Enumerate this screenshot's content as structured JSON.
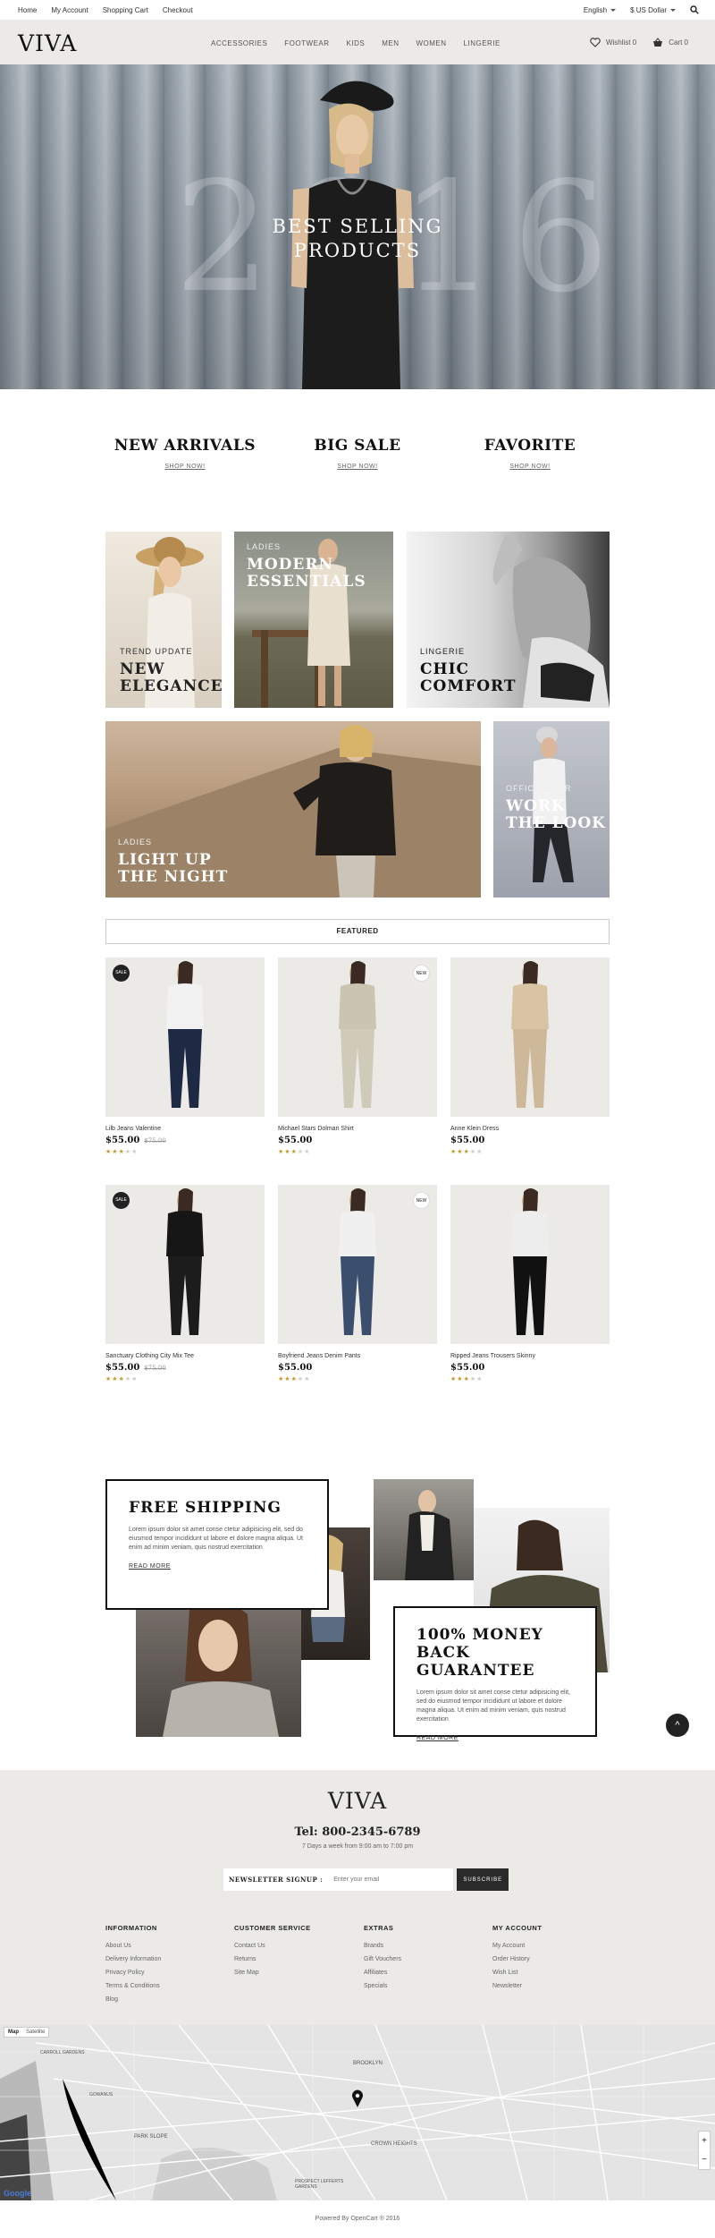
{
  "topbar": {
    "links": [
      "Home",
      "My Account",
      "Shopping Cart",
      "Checkout"
    ],
    "language": "English",
    "currency": "$ US Dollar"
  },
  "header": {
    "logo": "VIVA",
    "nav": [
      "ACCESSORIES",
      "FOOTWEAR",
      "KIDS",
      "MEN",
      "WOMEN",
      "LINGERIE"
    ],
    "wishlist": "Wishlist 0",
    "cart": "Cart 0"
  },
  "hero": {
    "year": "2016",
    "title_line1": "BEST SELLING",
    "title_line2": "PRODUCTS"
  },
  "categories": [
    {
      "title": "NEW ARRIVALS",
      "link": "SHOP NOW!"
    },
    {
      "title": "BIG SALE",
      "link": "SHOP NOW!"
    },
    {
      "title": "FAVORITE",
      "link": "SHOP NOW!"
    }
  ],
  "banners": [
    {
      "label": "TREND UPDATE",
      "title1": "NEW",
      "title2": "ELEGANCE"
    },
    {
      "label": "LADIES",
      "title1": "MODERN",
      "title2": "ESSENTIALS"
    },
    {
      "label": "LINGERIE",
      "title1": "CHIC",
      "title2": "COMFORT"
    },
    {
      "label": "LADIES",
      "title1": "LIGHT UP",
      "title2": "THE NIGHT"
    },
    {
      "label": "OFFICE WEAR",
      "title1": "WORK",
      "title2": "THE LOOK"
    }
  ],
  "featured": {
    "heading": "FEATURED",
    "products": [
      {
        "name": "Lilb Jeans Valentine",
        "price": "$55.00",
        "old": "$75.00",
        "badge": "SALE",
        "rating": 3
      },
      {
        "name": "Michael Stars Dolman Shirt",
        "price": "$55.00",
        "old": "",
        "badge": "NEW",
        "rating": 3
      },
      {
        "name": "Anne Klein Dress",
        "price": "$55.00",
        "old": "",
        "badge": "",
        "rating": 3
      },
      {
        "name": "Sanctuary Clothing City Mix Tee",
        "price": "$55.00",
        "old": "$75.00",
        "badge": "SALE",
        "rating": 3
      },
      {
        "name": "Boyfriend Jeans Denim Pants",
        "price": "$55.00",
        "old": "",
        "badge": "NEW",
        "rating": 3
      },
      {
        "name": "Ripped Jeans Trousers Skinny",
        "price": "$55.00",
        "old": "",
        "badge": "",
        "rating": 3
      }
    ]
  },
  "promo": {
    "shipping_title": "FREE SHIPPING",
    "shipping_text": "Lorem ipsum dolor sit amet conse ctetur adipisicing elit, sed do eiusmod tempor incididunt ut labore et dolore magna aliqua. Ut enim ad minim veniam, quis nostrud exercitation",
    "shipping_link": "READ MORE",
    "money_title1": "100% MONEY BACK",
    "money_title2": "GUARANTEE",
    "money_text": "Lorem ipsum dolor sit amet conse ctetur adipisicing elit, sed do eiusmod tempor incididunt ut labore et dolore magna aliqua. Ut enim ad minim veniam, quis nostrud exercitation",
    "money_link": "READ MORE"
  },
  "footer": {
    "logo": "VIVA",
    "tel": "Tel: 800-2345-6789",
    "hours": "7 Days a week from 9:00 am to 7:00 pm",
    "newsletter_label": "NEWSLETTER SIGNUP :",
    "newsletter_placeholder": "Enter your email",
    "newsletter_button": "SUBSCRIBE",
    "columns": [
      {
        "title": "INFORMATION",
        "items": [
          "About Us",
          "Delivery Information",
          "Privacy Policy",
          "Terms & Conditions",
          "Blog"
        ]
      },
      {
        "title": "CUSTOMER SERVICE",
        "items": [
          "Contact Us",
          "Returns",
          "Site Map"
        ]
      },
      {
        "title": "EXTRAS",
        "items": [
          "Brands",
          "Gift Vouchers",
          "Affiliates",
          "Specials"
        ]
      },
      {
        "title": "MY ACCOUNT",
        "items": [
          "My Account",
          "Order History",
          "Wish List",
          "Newsletter"
        ]
      }
    ],
    "map_tabs": [
      "Map",
      "Satellite"
    ],
    "map_labels": [
      "BROOKLYN",
      "PARK SLOPE",
      "CROWN HEIGHTS",
      "PROSPECT LEFFERTS GARDENS",
      "GOWANUS",
      "CARROLL GARDENS"
    ],
    "map_brand": "Google",
    "powered": "Powered By OpenCart ® 2016"
  }
}
